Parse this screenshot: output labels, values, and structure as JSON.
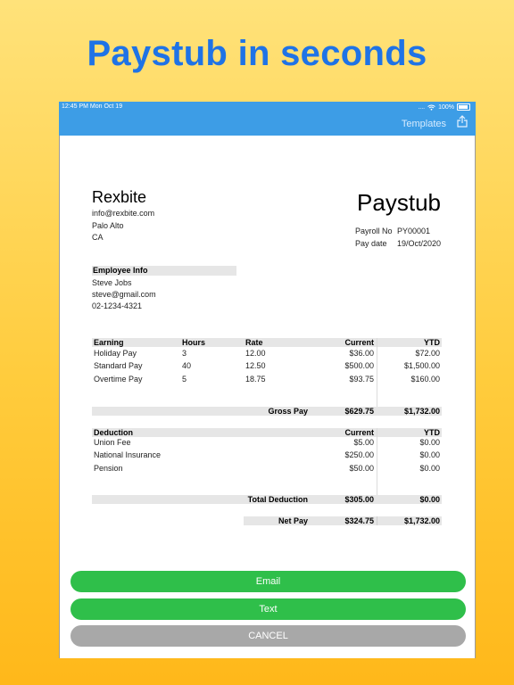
{
  "headline": "Paystub in seconds",
  "status_bar": {
    "time": "12:45 PM   Mon Oct 19",
    "signal": "....",
    "battery": "100%"
  },
  "nav": {
    "templates_label": "Templates",
    "share_icon": "share-icon"
  },
  "company": {
    "name": "Rexbite",
    "email": "info@rexbite.com",
    "city": "Palo Alto",
    "state": "CA"
  },
  "doc_title": "Paystub",
  "payroll": {
    "no_label": "Payroll No",
    "no_value": "PY00001",
    "date_label": "Pay date",
    "date_value": "19/Oct/2020"
  },
  "employee": {
    "header": "Employee Info",
    "name": "Steve Jobs",
    "email": "steve@gmail.com",
    "phone": "02-1234-4321"
  },
  "earnings": {
    "headers": {
      "earning": "Earning",
      "hours": "Hours",
      "rate": "Rate",
      "current": "Current",
      "ytd": "YTD"
    },
    "rows": [
      {
        "name": "Holiday Pay",
        "hours": "3",
        "rate": "12.00",
        "current": "$36.00",
        "ytd": "$72.00"
      },
      {
        "name": "Standard Pay",
        "hours": "40",
        "rate": "12.50",
        "current": "$500.00",
        "ytd": "$1,500.00"
      },
      {
        "name": "Overtime Pay",
        "hours": "5",
        "rate": "18.75",
        "current": "$93.75",
        "ytd": "$160.00"
      }
    ],
    "gross_label": "Gross Pay",
    "gross_current": "$629.75",
    "gross_ytd": "$1,732.00"
  },
  "deductions": {
    "headers": {
      "deduction": "Deduction",
      "current": "Current",
      "ytd": "YTD"
    },
    "rows": [
      {
        "name": "Union Fee",
        "current": "$5.00",
        "ytd": "$0.00"
      },
      {
        "name": "National Insurance",
        "current": "$250.00",
        "ytd": "$0.00"
      },
      {
        "name": "Pension",
        "current": "$50.00",
        "ytd": "$0.00"
      }
    ],
    "total_label": "Total Deduction",
    "total_current": "$305.00",
    "total_ytd": "$0.00"
  },
  "net": {
    "label": "Net Pay",
    "current": "$324.75",
    "ytd": "$1,732.00"
  },
  "buttons": {
    "email": "Email",
    "text": "Text",
    "cancel": "CANCEL"
  },
  "colors": {
    "accent_blue": "#1f73e6",
    "nav_blue": "#3d9de6",
    "button_green": "#2fbf4a",
    "button_gray": "#a8a8a8"
  }
}
